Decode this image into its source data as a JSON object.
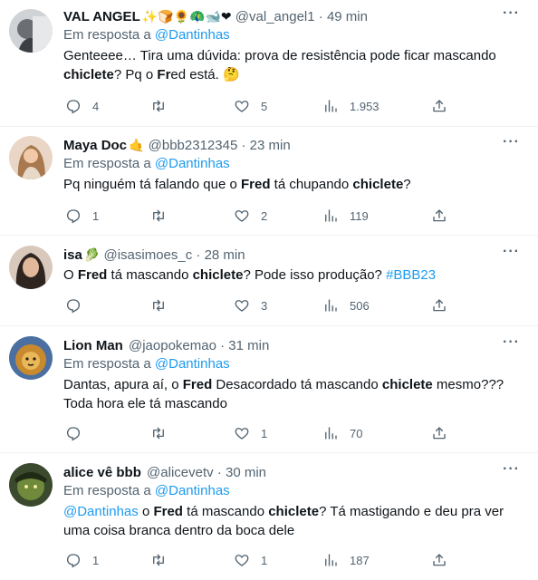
{
  "tweets": [
    {
      "name": "VAL ANGEL",
      "emojis": "✨🍞🌻🦚🐋❤",
      "handle": "@val_angel1",
      "time": "49 min",
      "reply_prefix": "Em resposta a ",
      "reply_to": "@Dantinhas",
      "text": [
        {
          "t": "Genteeee… Tira uma dúvida: prova de resistência pode ficar mascando "
        },
        {
          "t": "chiclete",
          "b": true
        },
        {
          "t": "? Pq o "
        },
        {
          "t": "Fr",
          "b": true
        },
        {
          "t": "ed está. 🤔"
        }
      ],
      "replies": "4",
      "retweets": "",
      "likes": "5",
      "views": "1.953"
    },
    {
      "name": "Maya Doc",
      "emojis": "🤙",
      "handle": "@bbb2312345",
      "time": "23 min",
      "reply_prefix": "Em resposta a ",
      "reply_to": "@Dantinhas",
      "text": [
        {
          "t": "Pq ninguém tá falando que o "
        },
        {
          "t": "Fred",
          "b": true
        },
        {
          "t": " tá chupando "
        },
        {
          "t": "chiclete",
          "b": true
        },
        {
          "t": "?"
        }
      ],
      "replies": "1",
      "retweets": "",
      "likes": "2",
      "views": "119"
    },
    {
      "name": "isa",
      "emojis": "🥬",
      "handle": "@isasimoes_c",
      "time": "28 min",
      "reply_prefix": "",
      "reply_to": "",
      "text": [
        {
          "t": "O "
        },
        {
          "t": "Fred",
          "b": true
        },
        {
          "t": " tá mascando "
        },
        {
          "t": "chiclete",
          "b": true
        },
        {
          "t": "? Pode isso produção? "
        },
        {
          "t": "#BBB23",
          "h": true
        }
      ],
      "replies": "",
      "retweets": "",
      "likes": "3",
      "views": "506"
    },
    {
      "name": "Lion Man",
      "emojis": "",
      "handle": "@jaopokemao",
      "time": "31 min",
      "reply_prefix": "Em resposta a ",
      "reply_to": "@Dantinhas",
      "text": [
        {
          "t": "Dantas, apura aí, o "
        },
        {
          "t": "Fred",
          "b": true
        },
        {
          "t": " Desacordado tá mascando "
        },
        {
          "t": "chiclete",
          "b": true
        },
        {
          "t": " mesmo???"
        },
        {
          "br": true
        },
        {
          "t": "Toda hora ele tá mascando"
        }
      ],
      "replies": "",
      "retweets": "",
      "likes": "1",
      "views": "70"
    },
    {
      "name": "alice vê bbb",
      "emojis": "",
      "handle": "@alicevetv",
      "time": "30 min",
      "reply_prefix": "Em resposta a ",
      "reply_to": "@Dantinhas",
      "text": [
        {
          "t": "@Dantinhas",
          "h": true
        },
        {
          "t": " o "
        },
        {
          "t": "Fred",
          "b": true
        },
        {
          "t": " tá mascando "
        },
        {
          "t": "chiclete",
          "b": true
        },
        {
          "t": "? Tá mastigando e deu pra ver uma coisa branca dentro da boca dele"
        }
      ],
      "replies": "1",
      "retweets": "",
      "likes": "1",
      "views": "187"
    }
  ],
  "separator": "·",
  "more_label": "···",
  "icons": {
    "reply": "reply-icon",
    "retweet": "retweet-icon",
    "like": "heart-icon",
    "views": "views-icon",
    "share": "share-icon",
    "more": "more-icon"
  },
  "colors": {
    "link": "#1d9bf0",
    "secondary": "#536471",
    "primary": "#0f1419",
    "border": "#eff3f4"
  }
}
